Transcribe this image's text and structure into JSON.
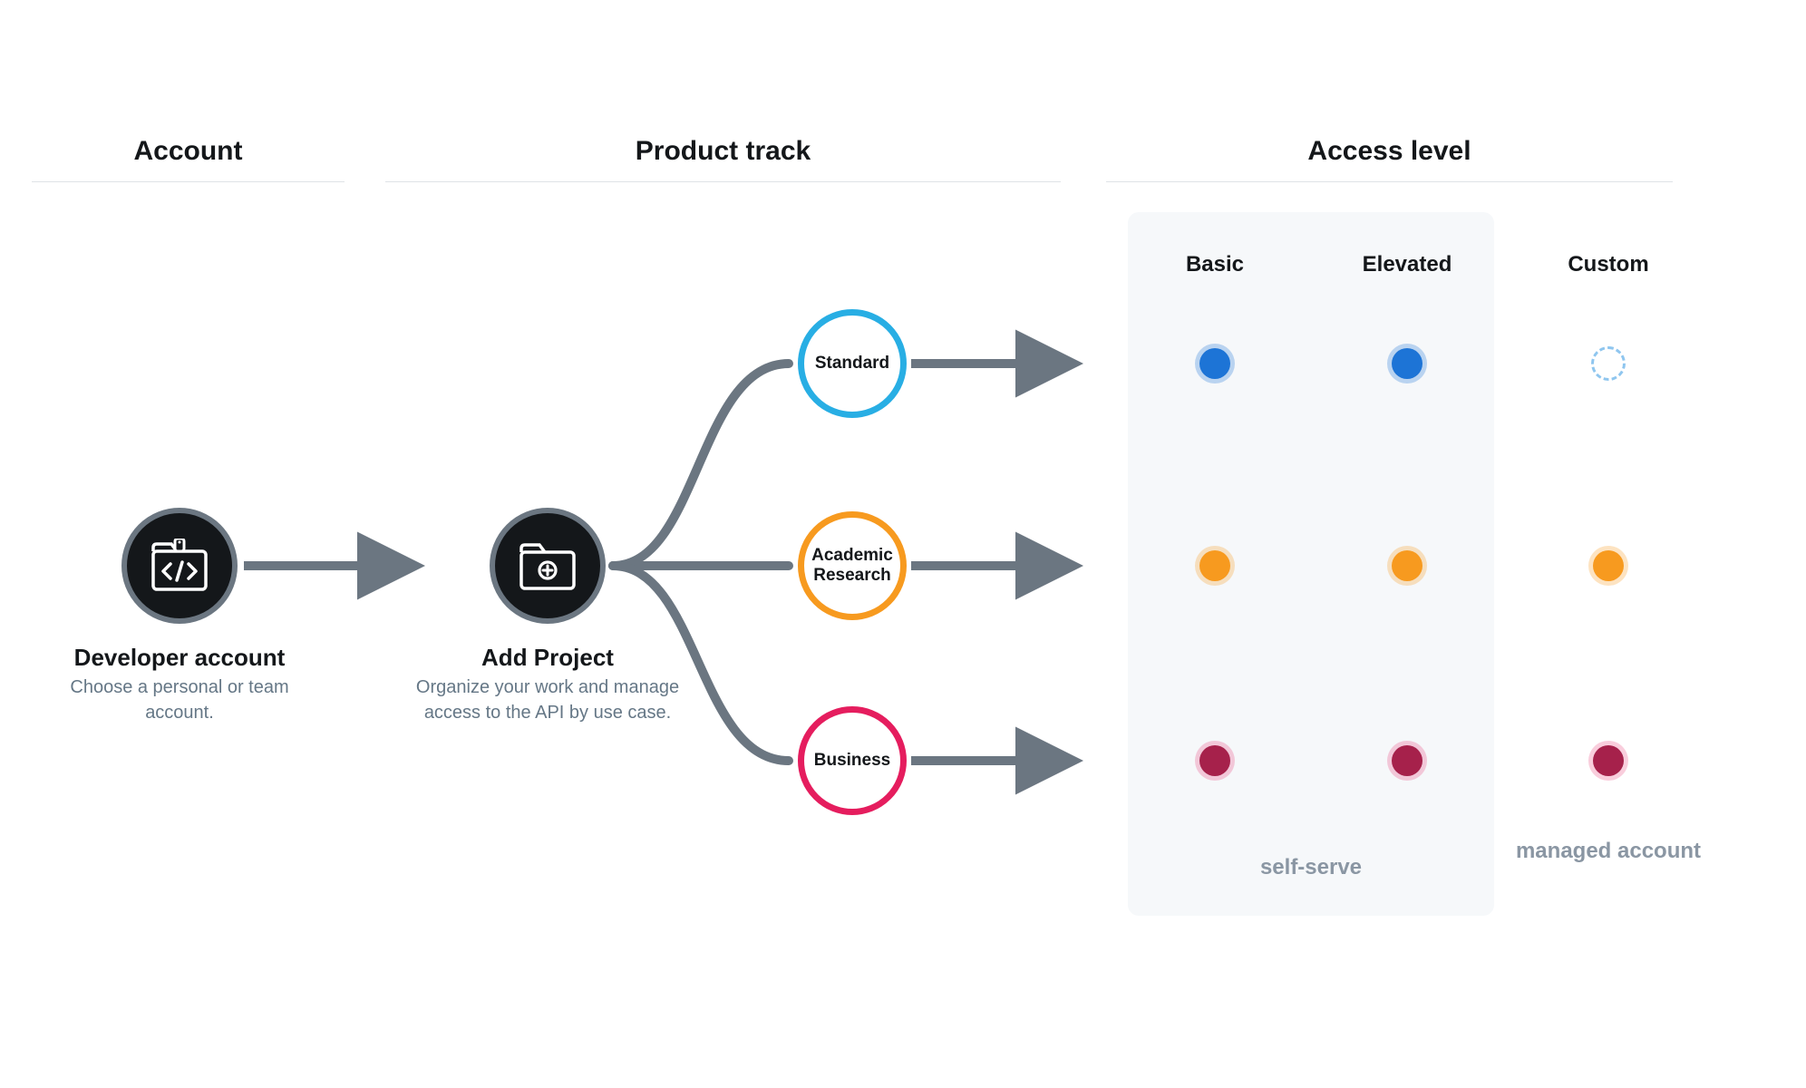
{
  "columns": {
    "account": {
      "header": "Account"
    },
    "track": {
      "header": "Product track"
    },
    "access": {
      "header": "Access level"
    }
  },
  "nodes": {
    "developer": {
      "title": "Developer account",
      "desc": "Choose a personal or team account."
    },
    "addProject": {
      "title": "Add Project",
      "desc": "Organize your work and manage access to the API by use case."
    }
  },
  "tracks": {
    "standard": {
      "label": "Standard",
      "color": "#28aee4"
    },
    "academic": {
      "label": "Academic Research",
      "color": "#f79a1f"
    },
    "business": {
      "label": "Business",
      "color": "#e51d5e"
    }
  },
  "accessLevels": {
    "basic": "Basic",
    "elevated": "Elevated",
    "custom": "Custom"
  },
  "footers": {
    "selfserve": "self-serve",
    "managed": "managed account"
  },
  "matrix": [
    {
      "track": "standard",
      "basic": "blue",
      "elevated": "blue",
      "custom": "dashed"
    },
    {
      "track": "academic",
      "basic": "orange",
      "elevated": "orange",
      "custom": "orange"
    },
    {
      "track": "business",
      "basic": "crimson",
      "elevated": "crimson",
      "custom": "crimson"
    }
  ]
}
